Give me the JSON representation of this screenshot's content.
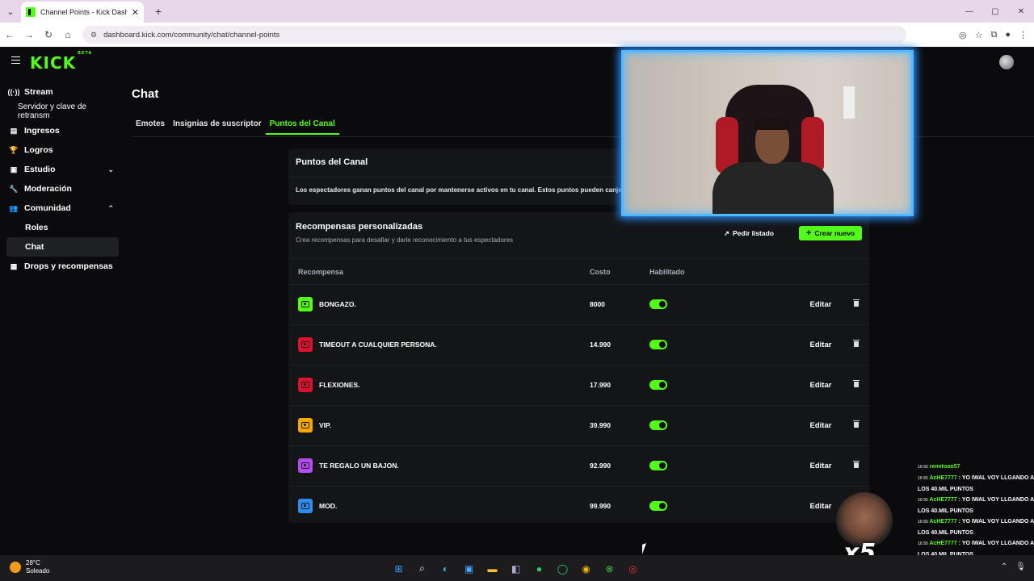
{
  "browser": {
    "tab_title": "Channel Points - Kick Dashboard",
    "url": "dashboard.kick.com/community/chat/channel-points"
  },
  "app": {
    "logo": "KICK",
    "logo_badge": "BETA"
  },
  "sidebar": {
    "items": [
      {
        "label": "Stream",
        "icon": "broadcast-icon"
      },
      {
        "label": "Servidor y clave de retransm",
        "icon": ""
      },
      {
        "label": "Ingresos",
        "icon": "money-icon"
      },
      {
        "label": "Logros",
        "icon": "trophy-icon"
      },
      {
        "label": "Estudio",
        "icon": "studio-icon"
      },
      {
        "label": "Moderación",
        "icon": "wrench-icon"
      },
      {
        "label": "Comunidad",
        "icon": "community-icon"
      },
      {
        "label": "Roles",
        "icon": ""
      },
      {
        "label": "Chat",
        "icon": ""
      },
      {
        "label": "Drops y recompensas",
        "icon": "gift-icon"
      }
    ]
  },
  "page": {
    "title": "Chat",
    "tabs": [
      "Emotes",
      "Insignias de suscriptor",
      "Puntos del Canal"
    ],
    "active_tab": "Puntos del Canal"
  },
  "channel_points": {
    "heading": "Puntos del Canal",
    "description": "Los espectadores ganan puntos del canal por mantenerse activos en tu canal. Estos puntos pueden canjearse por recompensas. Saber más",
    "enabled": true
  },
  "rewards": {
    "heading": "Recompensas personalizadas",
    "subheading": "Crea recompensas para desafiar y darle reconocimiento a tus espectadores",
    "list_button": "Pedir listado",
    "new_button": "Crear nuevo",
    "columns": [
      "Recompensa",
      "Costo",
      "Habilitado"
    ],
    "edit_label": "Editar",
    "rows": [
      {
        "name": "BONGAZO.",
        "cost": "8000",
        "color": "#53fc18",
        "enabled": true
      },
      {
        "name": "TIMEOUT A CUALQUIER PERSONA.",
        "cost": "14.990",
        "color": "#e0102f",
        "enabled": true
      },
      {
        "name": "FLEXIONES.",
        "cost": "17.990",
        "color": "#e0102f",
        "enabled": true
      },
      {
        "name": "VIP.",
        "cost": "39.990",
        "color": "#f5a800",
        "enabled": true
      },
      {
        "name": "TE REGALO UN BAJON.",
        "cost": "92.990",
        "color": "#b34cf5",
        "enabled": true
      },
      {
        "name": "MOD.",
        "cost": "99.990",
        "color": "#2d8cf0",
        "enabled": true
      }
    ]
  },
  "overlay": {
    "chat_lines": [
      {
        "time": "10:55",
        "user": "renvtooo57",
        "msg": ""
      },
      {
        "time": "10:55",
        "user": "AcHE7777",
        "msg": "YO IWAL VOY LLGANDO A LOS 40.MIL PUNTOS"
      },
      {
        "time": "10:55",
        "user": "AcHE7777",
        "msg": "YO IWAL VOY LLGANDO A LOS 40.MIL PUNTOS"
      },
      {
        "time": "10:55",
        "user": "AcHE7777",
        "msg": "YO IWAL VOY LLGANDO A LOS 40.MIL PUNTOS"
      },
      {
        "time": "10:55",
        "user": "AcHE7777",
        "msg": "YO IWAL VOY LLGANDO A LOS 40.MIL PUNTOS"
      }
    ],
    "multiplier": "x5"
  },
  "taskbar": {
    "temperature": "28°C",
    "condition": "Soleado"
  },
  "colors": {
    "accent": "#53fc18",
    "background": "#0b0b0d",
    "card": "#141517"
  }
}
